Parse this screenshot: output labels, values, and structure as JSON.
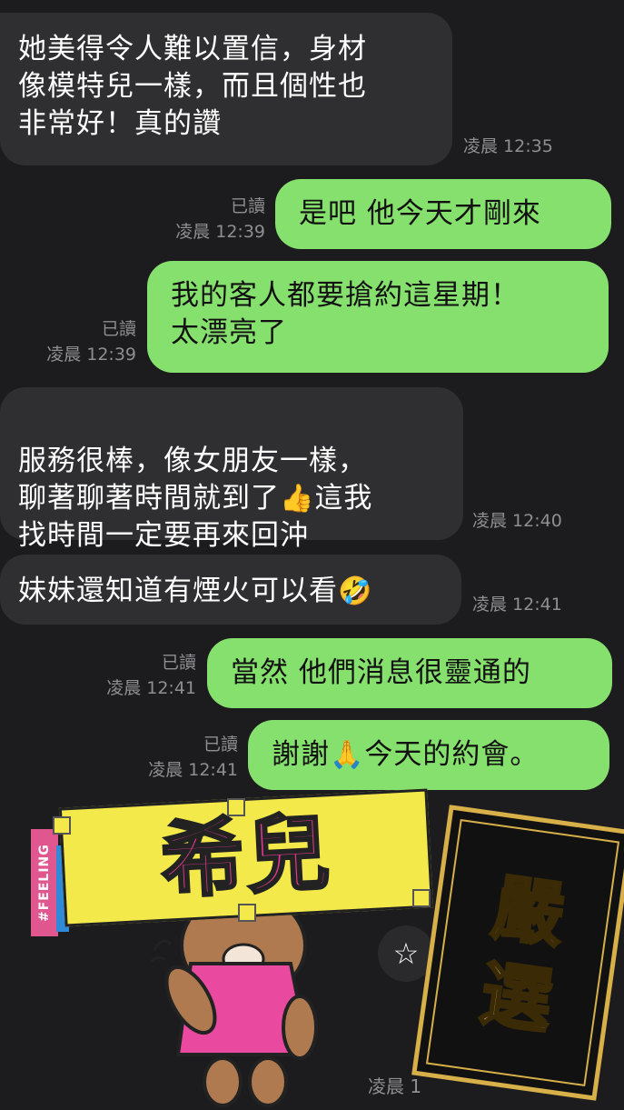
{
  "messages": [
    {
      "id": "m1",
      "side": "in",
      "text": "她美得令人難以置信，身材\n像模特兒一樣，而且個性也\n非常好！真的讚",
      "time": "凌晨 12:35"
    },
    {
      "id": "m2",
      "side": "out",
      "text": "是吧 他今天才剛來",
      "read": "已讀",
      "time": "凌晨 12:39"
    },
    {
      "id": "m3",
      "side": "out",
      "text": "我的客人都要搶約這星期！\n太漂亮了",
      "read": "已讀",
      "time": "凌晨 12:39"
    },
    {
      "id": "m4",
      "side": "in",
      "text_a": "服務很棒，像女朋友一樣，\n聊著聊著時間就到了",
      "emoji": "👍",
      "text_b": "這我\n找時間一定要再來回沖",
      "time": "凌晨 12:40"
    },
    {
      "id": "m5",
      "side": "in",
      "text": "妹妹還知道有煙火可以看",
      "emoji": "🤣",
      "time": "凌晨 12:41"
    },
    {
      "id": "m6",
      "side": "out",
      "text": "當然 他們消息很靈通的",
      "read": "已讀",
      "time": "凌晨 12:41"
    },
    {
      "id": "m7",
      "side": "out",
      "text_a": "謝謝",
      "emoji": "🙏",
      "text_b": "今天的約會。",
      "read": "已讀",
      "time": "凌晨 12:41"
    }
  ],
  "sticker": {
    "banner_text": "希兒",
    "tag_text": "#FEELING",
    "time_partial": "凌晨 1"
  },
  "overlay": {
    "gold_text_1": "嚴",
    "gold_text_2": "選"
  },
  "star_icon": "star-icon"
}
